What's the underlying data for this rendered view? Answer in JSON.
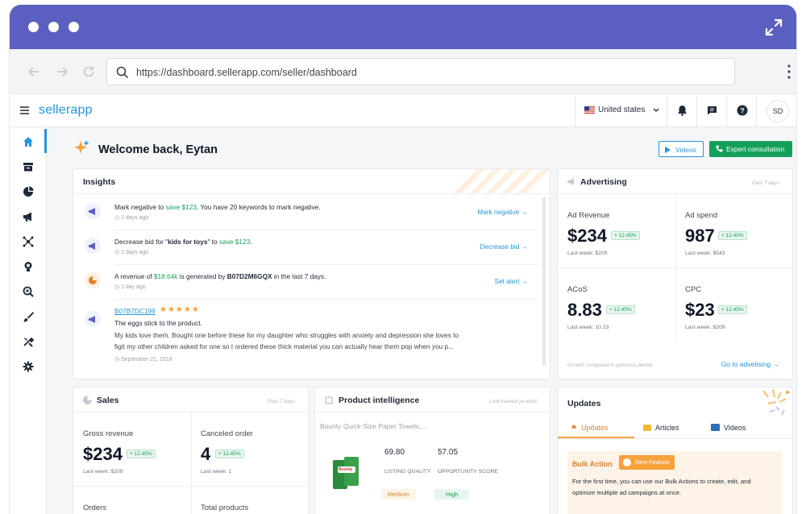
{
  "browser": {
    "url": "https://dashboard.sellerapp.com/seller/dashboard"
  },
  "app": {
    "logo": "sellerapp",
    "country": "United states",
    "avatar_initials": "SD",
    "accent": "#2596d9"
  },
  "header": {
    "welcome": "Welcome back, Eytan",
    "videos_label": "Videos",
    "expert_label": "Expert consultation"
  },
  "insights": {
    "title": "Insights",
    "items": [
      {
        "pre": "Mark negative to ",
        "highlight": "save $123",
        "post": ". You have 20 keywords to mark negative.",
        "time": "2 days ago",
        "action": "Mark negative"
      },
      {
        "pre": "Decrease bid for \"",
        "bold": "kids for toys",
        "mid": "\" to ",
        "highlight": "save $123",
        "post": ".",
        "time": "2 days ago",
        "action": "Decrease bid"
      },
      {
        "pre": "A revenue of ",
        "highlight": "$18.64k",
        "mid": " is generated by ",
        "bold": "B07D2M6GQX",
        "post": " in the last 7 days.",
        "time": "1 day ago",
        "action": "Set alert"
      }
    ],
    "review": {
      "asin": "B07B7DC199",
      "stars": "★★★★★",
      "headline": "The eggs stick to the product.",
      "body_line1": "My kids love them. Bought one before these for my daughter who struggles with anxiety and depression she loves to",
      "body_line2": "figit my other children asked for one so I ordered these thick material you can actually hear them pop when you p...",
      "date": "September 21, 2018"
    }
  },
  "advertising": {
    "title": "Advertising",
    "period": "Past 7 days",
    "metrics": [
      {
        "label": "Ad Revenue",
        "value": "$234",
        "change": "+ 12.45%",
        "last": "Last week: $209"
      },
      {
        "label": "Ad spend",
        "value": "987",
        "change": "+ 12.45%",
        "last": "Last week: $543"
      },
      {
        "label": "ACoS",
        "value": "8.83",
        "change": "+ 12.45%",
        "last": "Last week: 10.23"
      },
      {
        "label": "CPC",
        "value": "$23",
        "change": "+ 12.45%",
        "last": "Last week: $209"
      }
    ],
    "footnote": "Growth compared to previous period",
    "link": "Go to advetising"
  },
  "sales": {
    "title": "Sales",
    "period": "Past 7 days",
    "metrics": [
      {
        "label": "Gross revenue",
        "value": "$234",
        "change": "+ 12.45%",
        "last": "Last week: $209"
      },
      {
        "label": "Canceled order",
        "value": "4",
        "change": "+ 12.45%",
        "last": "Last week: 1"
      }
    ],
    "more_labels": [
      "Orders",
      "Total products"
    ]
  },
  "product_intelligence": {
    "title": "Product intelligence",
    "period": "Last tracked product",
    "product": "Bounty Quick-Size Paper Towels,...",
    "listing_quality": "69.80",
    "listing_quality_label": "LISTING QUALITY",
    "listing_quality_rating": "Medium",
    "opportunity_score": "57.05",
    "opportunity_score_label": "OPPORTUNITY SCORE",
    "opportunity_score_rating": "High",
    "image_brand": "Bounty"
  },
  "updates": {
    "title": "Updates",
    "tabs": [
      "Updates",
      "Articles",
      "Videos"
    ],
    "bulk_title": "Bulk Action",
    "badge": "New Feature",
    "desc_line1": "For the first time, you can use our Bulk Actions to create, edit, and",
    "desc_line2": "optimize multiple ad campaigns at once."
  }
}
